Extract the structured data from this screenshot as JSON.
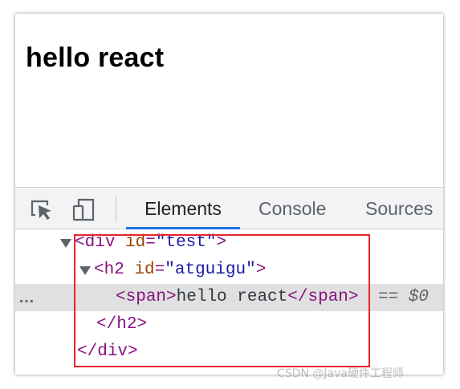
{
  "page": {
    "heading": "hello react"
  },
  "devtools": {
    "toolbar": {
      "inspect_icon": "element-picker-icon",
      "device_icon": "device-toolbar-icon",
      "tabs": [
        {
          "label": "Elements",
          "active": true
        },
        {
          "label": "Console",
          "active": false
        },
        {
          "label": "Sources",
          "active": false
        }
      ]
    },
    "dom_tree": {
      "rows": [
        {
          "open_tag": "div",
          "attr_name": "id",
          "attr_value": "\"test\""
        },
        {
          "open_tag": "h2",
          "attr_name": "id",
          "attr_value": "\"atguigu\""
        },
        {
          "ellipsis": "…",
          "tag": "span",
          "text": "hello react",
          "marker": "== $0",
          "selected": true
        },
        {
          "close_tag": "h2"
        },
        {
          "close_tag": "div"
        }
      ]
    },
    "highlight_color": "#e5252a",
    "accent_color": "#1a73e8"
  },
  "watermark": "CSDN @Java硬件工程师"
}
